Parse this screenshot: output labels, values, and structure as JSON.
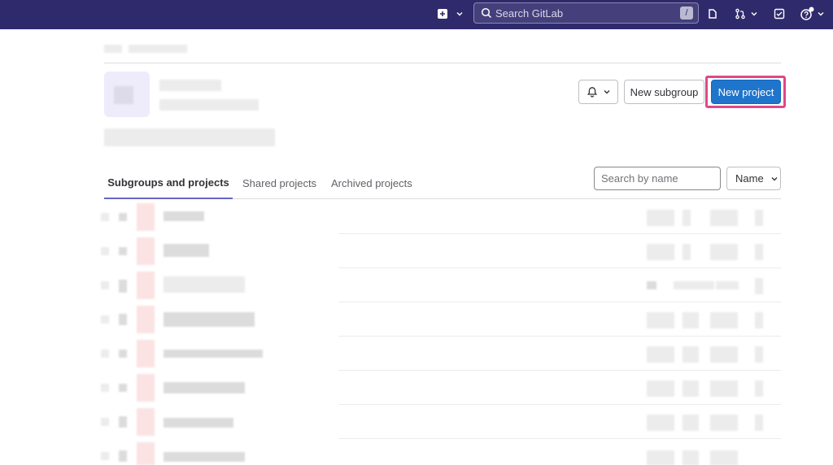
{
  "topbar": {
    "search_placeholder": "Search GitLab",
    "search_shortcut": "/",
    "icons": [
      "plus-square-icon",
      "chevron-down-icon",
      "search-icon",
      "issues-icon",
      "merge-request-icon",
      "todo-icon",
      "help-icon"
    ]
  },
  "group_header": {
    "notification_button": "notifications-bell",
    "new_subgroup_label": "New subgroup",
    "new_project_label": "New project"
  },
  "tabs": [
    {
      "label": "Subgroups and projects",
      "active": true
    },
    {
      "label": "Shared projects",
      "active": false
    },
    {
      "label": "Archived projects",
      "active": false
    }
  ],
  "filter": {
    "search_placeholder": "Search by name",
    "sort_label": "Name"
  },
  "colors": {
    "topbar": "#2f2a6b",
    "primary": "#1f75cb",
    "highlight": "#e0478a",
    "active_tab": "#6666c4"
  }
}
